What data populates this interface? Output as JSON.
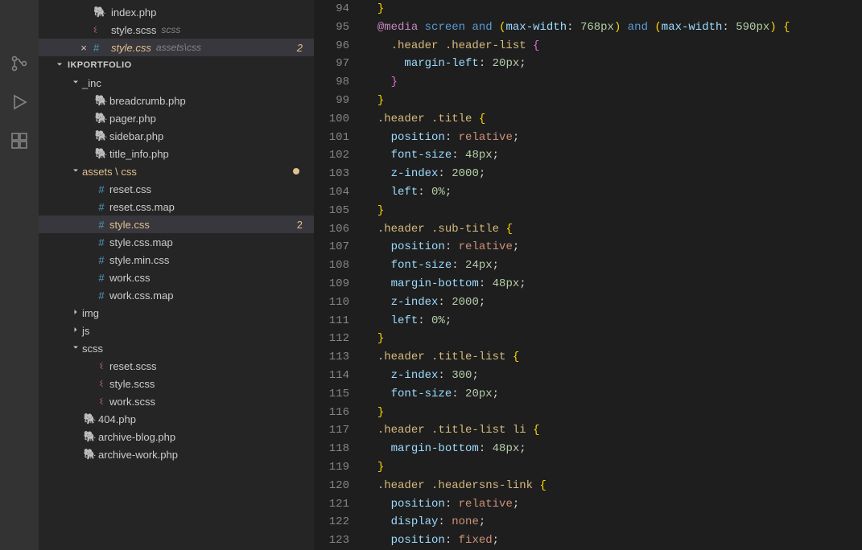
{
  "activityBar": {
    "items": [
      "source-control-icon",
      "run-debug-icon",
      "extensions-icon"
    ]
  },
  "openEditors": [
    {
      "icon": "php",
      "filename": "index.php",
      "path": "",
      "close": ""
    },
    {
      "icon": "scss",
      "filename": "style.scss",
      "path": "scss",
      "close": ""
    },
    {
      "icon": "css",
      "filename": "style.css",
      "path": "assets\\css",
      "close": "×",
      "active": true,
      "badge": "2"
    }
  ],
  "projectName": "IKPORTFOLIO",
  "tree": [
    {
      "type": "folder",
      "depth": 1,
      "expanded": true,
      "label": "_inc"
    },
    {
      "type": "file",
      "depth": 2,
      "icon": "php",
      "label": "breadcrumb.php"
    },
    {
      "type": "file",
      "depth": 2,
      "icon": "php",
      "label": "pager.php"
    },
    {
      "type": "file",
      "depth": 2,
      "icon": "php",
      "label": "sidebar.php"
    },
    {
      "type": "file",
      "depth": 2,
      "icon": "php",
      "label": "title_info.php"
    },
    {
      "type": "folder",
      "depth": 1,
      "expanded": true,
      "label": "assets \\ css",
      "modified": true,
      "dot": true
    },
    {
      "type": "file",
      "depth": 2,
      "icon": "css",
      "label": "reset.css"
    },
    {
      "type": "file",
      "depth": 2,
      "icon": "css",
      "label": "reset.css.map"
    },
    {
      "type": "file",
      "depth": 2,
      "icon": "css",
      "label": "style.css",
      "selected": true,
      "modified": true,
      "badge": "2"
    },
    {
      "type": "file",
      "depth": 2,
      "icon": "css",
      "label": "style.css.map"
    },
    {
      "type": "file",
      "depth": 2,
      "icon": "css",
      "label": "style.min.css"
    },
    {
      "type": "file",
      "depth": 2,
      "icon": "css",
      "label": "work.css"
    },
    {
      "type": "file",
      "depth": 2,
      "icon": "css",
      "label": "work.css.map"
    },
    {
      "type": "folder",
      "depth": 1,
      "expanded": false,
      "label": "img"
    },
    {
      "type": "folder",
      "depth": 1,
      "expanded": false,
      "label": "js"
    },
    {
      "type": "folder",
      "depth": 1,
      "expanded": true,
      "label": "scss"
    },
    {
      "type": "file",
      "depth": 2,
      "icon": "scss",
      "label": "reset.scss"
    },
    {
      "type": "file",
      "depth": 2,
      "icon": "scss",
      "label": "style.scss"
    },
    {
      "type": "file",
      "depth": 2,
      "icon": "scss",
      "label": "work.scss"
    },
    {
      "type": "file",
      "depth": 1,
      "icon": "php",
      "label": "404.php"
    },
    {
      "type": "file",
      "depth": 1,
      "icon": "php",
      "label": "archive-blog.php"
    },
    {
      "type": "file",
      "depth": 1,
      "icon": "php",
      "label": "archive-work.php"
    }
  ],
  "code": {
    "startLine": 94,
    "lines": [
      {
        "t": [
          [
            "  ",
            ""
          ],
          [
            "}",
            "brace-y"
          ]
        ]
      },
      {
        "t": [
          [
            "  ",
            ""
          ],
          [
            "@media",
            "at"
          ],
          [
            " ",
            ""
          ],
          [
            "screen",
            "kw"
          ],
          [
            " ",
            ""
          ],
          [
            "and",
            "kw"
          ],
          [
            " ",
            ""
          ],
          [
            "(",
            "paren"
          ],
          [
            "max-width",
            "prop"
          ],
          [
            ": ",
            ""
          ],
          [
            "768px",
            "num"
          ],
          [
            ")",
            "paren"
          ],
          [
            " ",
            ""
          ],
          [
            "and",
            "kw"
          ],
          [
            " ",
            ""
          ],
          [
            "(",
            "paren"
          ],
          [
            "max-width",
            "prop"
          ],
          [
            ": ",
            ""
          ],
          [
            "590px",
            "num"
          ],
          [
            ")",
            "paren"
          ],
          [
            " ",
            ""
          ],
          [
            "{",
            "brace-y"
          ]
        ]
      },
      {
        "t": [
          [
            "    ",
            ""
          ],
          [
            ".header .header-list",
            "sel"
          ],
          [
            " ",
            ""
          ],
          [
            "{",
            "brace-p"
          ]
        ]
      },
      {
        "t": [
          [
            "      ",
            ""
          ],
          [
            "margin-left",
            "prop"
          ],
          [
            ": ",
            ""
          ],
          [
            "20px",
            "num"
          ],
          [
            ";",
            ""
          ]
        ]
      },
      {
        "t": [
          [
            "    ",
            ""
          ],
          [
            "}",
            "brace-p"
          ]
        ]
      },
      {
        "t": [
          [
            "  ",
            ""
          ],
          [
            "}",
            "brace-y"
          ]
        ]
      },
      {
        "t": [
          [
            "  ",
            ""
          ],
          [
            ".header .title",
            "sel"
          ],
          [
            " ",
            ""
          ],
          [
            "{",
            "brace-y"
          ]
        ]
      },
      {
        "t": [
          [
            "    ",
            ""
          ],
          [
            "position",
            "prop"
          ],
          [
            ": ",
            ""
          ],
          [
            "relative",
            "val"
          ],
          [
            ";",
            ""
          ]
        ]
      },
      {
        "t": [
          [
            "    ",
            ""
          ],
          [
            "font-size",
            "prop"
          ],
          [
            ": ",
            ""
          ],
          [
            "48px",
            "num"
          ],
          [
            ";",
            ""
          ]
        ]
      },
      {
        "t": [
          [
            "    ",
            ""
          ],
          [
            "z-index",
            "prop"
          ],
          [
            ": ",
            ""
          ],
          [
            "2000",
            "num"
          ],
          [
            ";",
            ""
          ]
        ]
      },
      {
        "t": [
          [
            "    ",
            ""
          ],
          [
            "left",
            "prop"
          ],
          [
            ": ",
            ""
          ],
          [
            "0%",
            "num"
          ],
          [
            ";",
            ""
          ]
        ]
      },
      {
        "t": [
          [
            "  ",
            ""
          ],
          [
            "}",
            "brace-y"
          ]
        ]
      },
      {
        "t": [
          [
            "  ",
            ""
          ],
          [
            ".header .sub-title",
            "sel"
          ],
          [
            " ",
            ""
          ],
          [
            "{",
            "brace-y"
          ]
        ]
      },
      {
        "t": [
          [
            "    ",
            ""
          ],
          [
            "position",
            "prop"
          ],
          [
            ": ",
            ""
          ],
          [
            "relative",
            "val"
          ],
          [
            ";",
            ""
          ]
        ]
      },
      {
        "t": [
          [
            "    ",
            ""
          ],
          [
            "font-size",
            "prop"
          ],
          [
            ": ",
            ""
          ],
          [
            "24px",
            "num"
          ],
          [
            ";",
            ""
          ]
        ]
      },
      {
        "t": [
          [
            "    ",
            ""
          ],
          [
            "margin-bottom",
            "prop"
          ],
          [
            ": ",
            ""
          ],
          [
            "48px",
            "num"
          ],
          [
            ";",
            ""
          ]
        ]
      },
      {
        "t": [
          [
            "    ",
            ""
          ],
          [
            "z-index",
            "prop"
          ],
          [
            ": ",
            ""
          ],
          [
            "2000",
            "num"
          ],
          [
            ";",
            ""
          ]
        ]
      },
      {
        "t": [
          [
            "    ",
            ""
          ],
          [
            "left",
            "prop"
          ],
          [
            ": ",
            ""
          ],
          [
            "0%",
            "num"
          ],
          [
            ";",
            ""
          ]
        ]
      },
      {
        "t": [
          [
            "  ",
            ""
          ],
          [
            "}",
            "brace-y"
          ]
        ]
      },
      {
        "t": [
          [
            "  ",
            ""
          ],
          [
            ".header .title-list",
            "sel"
          ],
          [
            " ",
            ""
          ],
          [
            "{",
            "brace-y"
          ]
        ]
      },
      {
        "t": [
          [
            "    ",
            ""
          ],
          [
            "z-index",
            "prop"
          ],
          [
            ": ",
            ""
          ],
          [
            "300",
            "num"
          ],
          [
            ";",
            ""
          ]
        ]
      },
      {
        "t": [
          [
            "    ",
            ""
          ],
          [
            "font-size",
            "prop"
          ],
          [
            ": ",
            ""
          ],
          [
            "20px",
            "num"
          ],
          [
            ";",
            ""
          ]
        ]
      },
      {
        "t": [
          [
            "  ",
            ""
          ],
          [
            "}",
            "brace-y"
          ]
        ]
      },
      {
        "t": [
          [
            "  ",
            ""
          ],
          [
            ".header .title-list li",
            "sel"
          ],
          [
            " ",
            ""
          ],
          [
            "{",
            "brace-y"
          ]
        ]
      },
      {
        "t": [
          [
            "    ",
            ""
          ],
          [
            "margin-bottom",
            "prop"
          ],
          [
            ": ",
            ""
          ],
          [
            "48px",
            "num"
          ],
          [
            ";",
            ""
          ]
        ]
      },
      {
        "t": [
          [
            "  ",
            ""
          ],
          [
            "}",
            "brace-y"
          ]
        ]
      },
      {
        "t": [
          [
            "  ",
            ""
          ],
          [
            ".header .headersns-link",
            "sel"
          ],
          [
            " ",
            ""
          ],
          [
            "{",
            "brace-y"
          ]
        ]
      },
      {
        "t": [
          [
            "    ",
            ""
          ],
          [
            "position",
            "prop"
          ],
          [
            ": ",
            ""
          ],
          [
            "relative",
            "val"
          ],
          [
            ";",
            ""
          ]
        ]
      },
      {
        "t": [
          [
            "    ",
            ""
          ],
          [
            "display",
            "prop"
          ],
          [
            ": ",
            ""
          ],
          [
            "none",
            "val"
          ],
          [
            ";",
            ""
          ]
        ]
      },
      {
        "t": [
          [
            "    ",
            ""
          ],
          [
            "position",
            "prop"
          ],
          [
            ": ",
            ""
          ],
          [
            "fixed",
            "val"
          ],
          [
            ";",
            ""
          ]
        ]
      }
    ]
  }
}
